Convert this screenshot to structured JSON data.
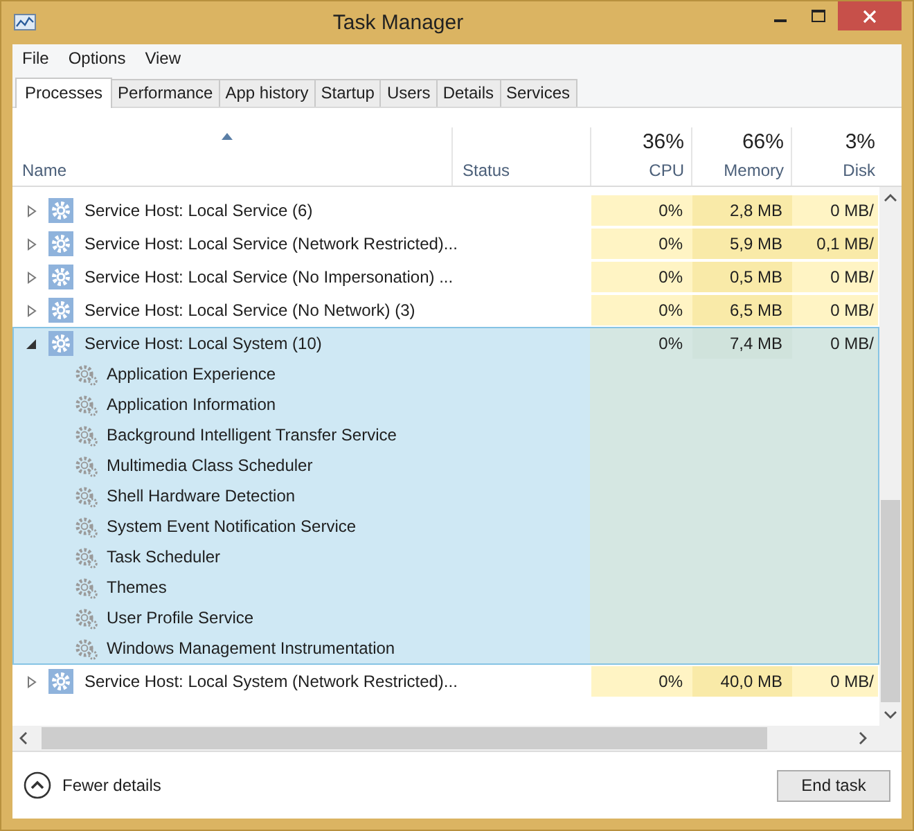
{
  "window": {
    "title": "Task Manager"
  },
  "menu": [
    "File",
    "Options",
    "View"
  ],
  "tabs": [
    {
      "label": "Processes",
      "selected": true
    },
    {
      "label": "Performance",
      "selected": false
    },
    {
      "label": "App history",
      "selected": false
    },
    {
      "label": "Startup",
      "selected": false
    },
    {
      "label": "Users",
      "selected": false
    },
    {
      "label": "Details",
      "selected": false
    },
    {
      "label": "Services",
      "selected": false
    }
  ],
  "table": {
    "columns": [
      {
        "label": "Name"
      },
      {
        "label": "Status"
      },
      {
        "label": "CPU",
        "total": "36%"
      },
      {
        "label": "Memory",
        "total": "66%"
      },
      {
        "label": "Disk",
        "total": "3%"
      }
    ],
    "rows": [
      {
        "name": "Service Host: Local Service (6)",
        "expanded": false,
        "selected": false,
        "cpu": {
          "value": "0%",
          "hot": false
        },
        "memory": {
          "value": "2,8 MB",
          "hot": true
        },
        "disk": {
          "value": "0 MB/",
          "hot": false
        }
      },
      {
        "name": "Service Host: Local Service (Network Restricted)...",
        "expanded": false,
        "selected": false,
        "cpu": {
          "value": "0%",
          "hot": false
        },
        "memory": {
          "value": "5,9 MB",
          "hot": true
        },
        "disk": {
          "value": "0,1 MB/",
          "hot": true
        }
      },
      {
        "name": "Service Host: Local Service (No Impersonation) ...",
        "expanded": false,
        "selected": false,
        "cpu": {
          "value": "0%",
          "hot": false
        },
        "memory": {
          "value": "0,5 MB",
          "hot": true
        },
        "disk": {
          "value": "0 MB/",
          "hot": false
        }
      },
      {
        "name": "Service Host: Local Service (No Network) (3)",
        "expanded": false,
        "selected": false,
        "cpu": {
          "value": "0%",
          "hot": false
        },
        "memory": {
          "value": "6,5 MB",
          "hot": true
        },
        "disk": {
          "value": "0 MB/",
          "hot": false
        }
      },
      {
        "name": "Service Host: Local System (10)",
        "expanded": true,
        "selected": true,
        "cpu": {
          "value": "0%",
          "hot": false
        },
        "memory": {
          "value": "7,4 MB",
          "hot": true
        },
        "disk": {
          "value": "0 MB/",
          "hot": false
        },
        "children": [
          "Application Experience",
          "Application Information",
          "Background Intelligent Transfer Service",
          "Multimedia Class Scheduler",
          "Shell Hardware Detection",
          "System Event Notification Service",
          "Task Scheduler",
          "Themes",
          "User Profile Service",
          "Windows Management Instrumentation"
        ]
      },
      {
        "name": "Service Host: Local System (Network Restricted)...",
        "expanded": false,
        "selected": false,
        "cpu": {
          "value": "0%",
          "hot": false
        },
        "memory": {
          "value": "40,0 MB",
          "hot": true
        },
        "disk": {
          "value": "0 MB/",
          "hot": false
        }
      }
    ]
  },
  "footer": {
    "toggle": "Fewer details",
    "button": "End task"
  }
}
